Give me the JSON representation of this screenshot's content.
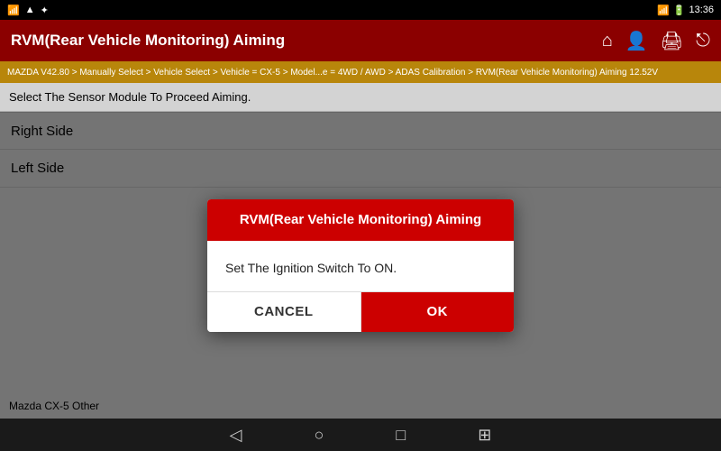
{
  "status_bar": {
    "left_icons": [
      "wifi",
      "signal",
      "time"
    ],
    "time": "13:36",
    "battery": "97%"
  },
  "header": {
    "title": "RVM(Rear Vehicle Monitoring) Aiming",
    "icons": [
      "home",
      "user",
      "print",
      "exit"
    ]
  },
  "breadcrumb": {
    "text": "MAZDA V42.80 > Manually Select > Vehicle Select > Vehicle = CX-5 > Model...e = 4WD / AWD > ADAS Calibration > RVM(Rear Vehicle Monitoring) Aiming    12.52V"
  },
  "instruction": {
    "text": "Select The Sensor Module To Proceed Aiming."
  },
  "sides": [
    {
      "label": "Right Side"
    },
    {
      "label": "Left Side"
    }
  ],
  "dialog": {
    "title": "RVM(Rear Vehicle Monitoring) Aiming",
    "message": "Set The Ignition Switch To ON.",
    "cancel_label": "CANCEL",
    "ok_label": "OK"
  },
  "bottom_label": {
    "text": "Mazda CX-5 Other"
  },
  "nav": {
    "back": "◁",
    "home_circle": "○",
    "square": "□",
    "square2": "▣"
  }
}
